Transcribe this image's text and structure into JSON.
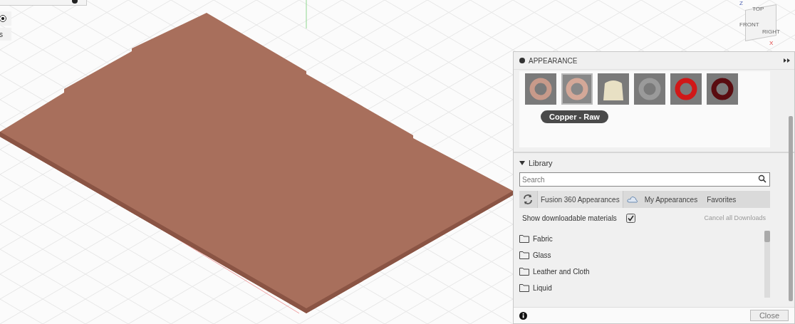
{
  "left_toolbar": {
    "radio_selected": true,
    "partial_label": "s"
  },
  "view_cube": {
    "faces": [
      "TOP",
      "FRONT",
      "RIGHT"
    ],
    "axes": [
      "Z",
      "X"
    ]
  },
  "appearance_panel": {
    "title": "APPEARANCE",
    "swatches": [
      {
        "kind": "ring",
        "color": "#c89a8a",
        "selected": false
      },
      {
        "kind": "ring",
        "color": "#d4a898",
        "selected": true
      },
      {
        "kind": "cloth",
        "color": "#e8e0c4",
        "selected": false
      },
      {
        "kind": "ring",
        "color": "#9a9a9a",
        "selected": false
      },
      {
        "kind": "ring",
        "color": "#d01818",
        "selected": false
      },
      {
        "kind": "ring",
        "color": "#5a0c10",
        "selected": false
      }
    ],
    "tooltip": "Copper - Raw",
    "library": {
      "title": "Library",
      "expanded": true,
      "search_placeholder": "Search",
      "tabs": [
        {
          "label": "Fusion 360 Appearances",
          "selected": true
        },
        {
          "label": "My Appearances",
          "selected": false
        },
        {
          "label": "Favorites",
          "selected": false
        }
      ],
      "show_downloadable": {
        "label": "Show downloadable materials",
        "checked": true
      },
      "cancel_downloads": {
        "label": "Cancel all Downloads",
        "disabled": true
      },
      "folders": [
        "Fabric",
        "Glass",
        "Leather and Cloth",
        "Liquid"
      ]
    },
    "close_button": "Close"
  }
}
